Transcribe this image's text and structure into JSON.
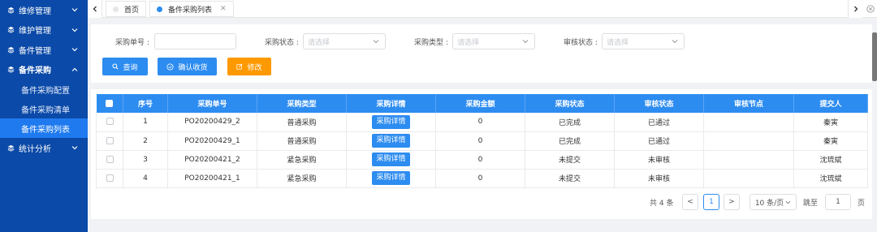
{
  "sidebar": {
    "items": [
      {
        "label": "维修管理"
      },
      {
        "label": "维护管理"
      },
      {
        "label": "备件管理"
      },
      {
        "label": "备件采购"
      },
      {
        "label": "统计分析"
      }
    ],
    "subitems": [
      {
        "label": "备件采购配置"
      },
      {
        "label": "备件采购清单"
      },
      {
        "label": "备件采购列表"
      }
    ]
  },
  "tabs": [
    {
      "label": "首页"
    },
    {
      "label": "备件采购列表"
    }
  ],
  "filters": {
    "order_no_label": "采购单号 :",
    "order_no_value": "",
    "status_label": "采购状态 :",
    "status_placeholder": "请选择",
    "type_label": "采购类型 :",
    "type_placeholder": "请选择",
    "review_label": "审核状态 :",
    "review_placeholder": "请选择"
  },
  "actions": {
    "query": "查询",
    "confirm_receipt": "确认收货",
    "edit": "修改"
  },
  "table": {
    "columns": [
      "序号",
      "采购单号",
      "采购类型",
      "采购详情",
      "采购金额",
      "采购状态",
      "审核状态",
      "审核节点",
      "提交人"
    ],
    "rows": [
      {
        "idx": "1",
        "order": "PO20200429_2",
        "type": "普通采购",
        "detail": "采购详情",
        "amount": "0",
        "status": "已完成",
        "review": "已通过",
        "node": "",
        "submitter": "秦寅"
      },
      {
        "idx": "2",
        "order": "PO20200429_1",
        "type": "普通采购",
        "detail": "采购详情",
        "amount": "0",
        "status": "已完成",
        "review": "已通过",
        "node": "",
        "submitter": "秦寅"
      },
      {
        "idx": "3",
        "order": "PO20200421_2",
        "type": "紧急采购",
        "detail": "采购详情",
        "amount": "0",
        "status": "未提交",
        "review": "未审核",
        "node": "",
        "submitter": "沈琉斌"
      },
      {
        "idx": "4",
        "order": "PO20200421_1",
        "type": "紧急采购",
        "detail": "采购详情",
        "amount": "0",
        "status": "未提交",
        "review": "未审核",
        "node": "",
        "submitter": "沈琉斌"
      }
    ]
  },
  "pagination": {
    "total": "共 4 条",
    "prev": "<",
    "current": "1",
    "next": ">",
    "page_size": "10 条/页",
    "goto_label": "跳至",
    "goto_value": "1",
    "page_suffix": "页"
  },
  "colors": {
    "sidebar_bg": "#0b4aa8",
    "accent": "#2d8cf0",
    "edit_button": "#ff9900"
  }
}
